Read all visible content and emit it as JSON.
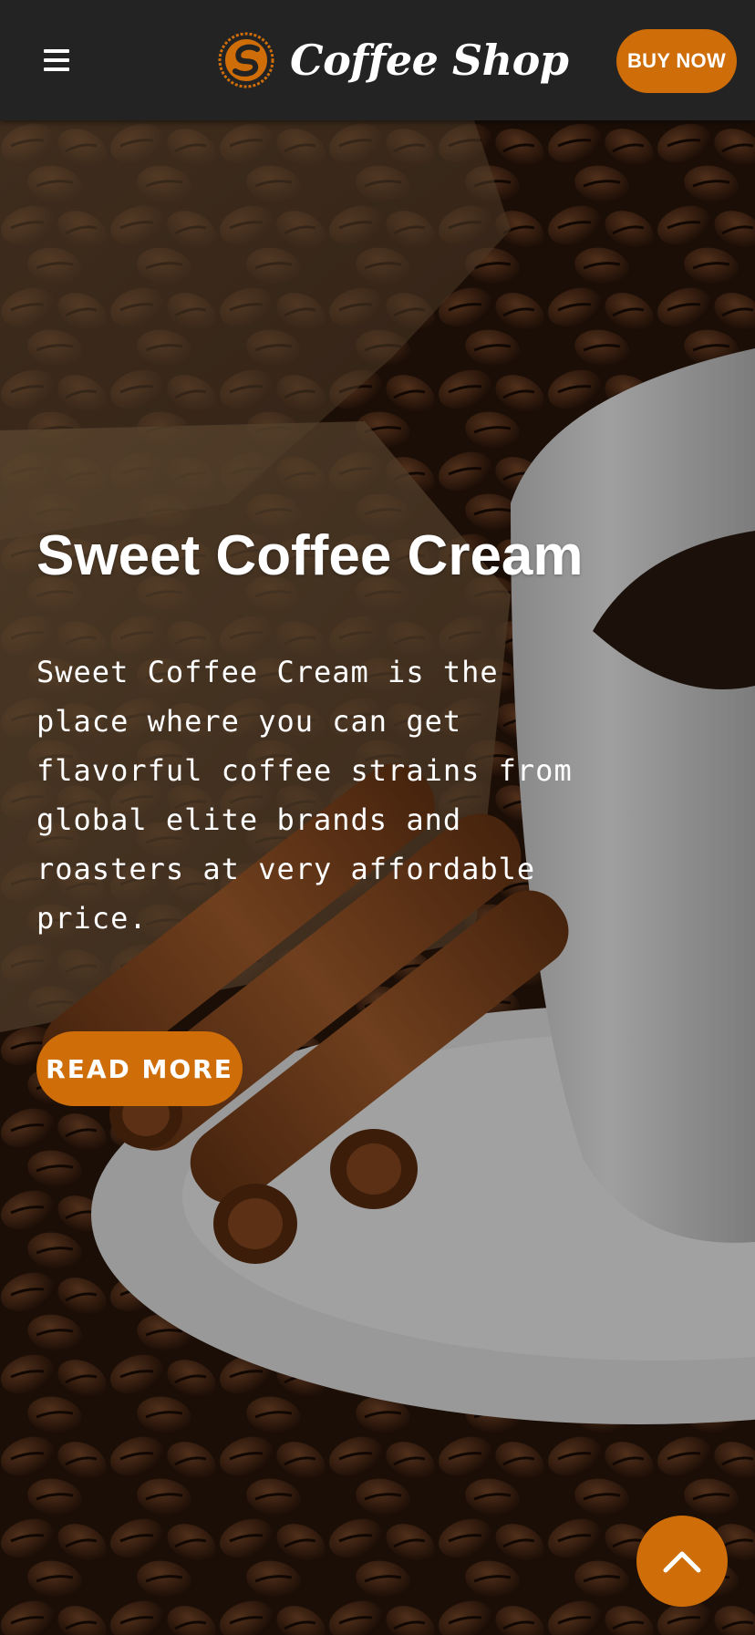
{
  "header": {
    "brand_name": "Coffee Shop",
    "buy_label": "BUY NOW",
    "menu_icon": "hamburger-menu-icon",
    "logo_icon": "coffee-bean-logo-icon"
  },
  "hero": {
    "title": "Sweet Coffee Cream",
    "description": "Sweet Coffee Cream is the place where you can get flavorful coffee strains from global elite brands and roasters at very affordable price.",
    "read_more_label": "READ MORE",
    "background_image": "coffee beans, cinnamon sticks and a white coffee cup on a saucer"
  },
  "scroll_top": {
    "icon": "chevron-up-icon"
  },
  "colors": {
    "accent": "#cf6d09",
    "navbar": "#232323",
    "text": "#ffffff"
  }
}
